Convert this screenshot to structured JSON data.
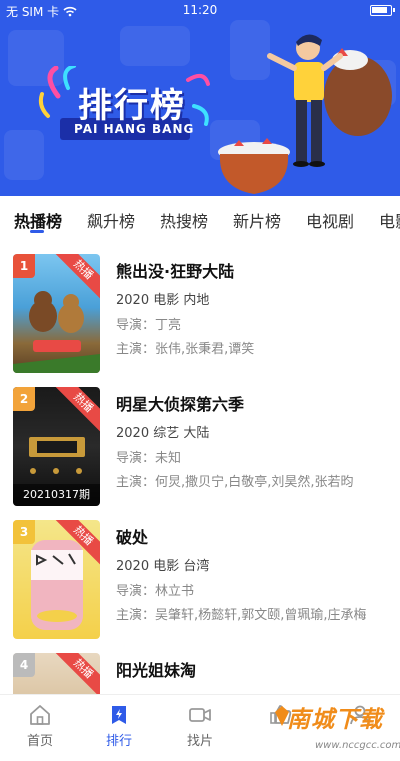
{
  "status_bar": {
    "carrier": "无 SIM 卡",
    "time": "11:20"
  },
  "banner": {
    "title": "排行榜",
    "subtitle": "PAI HANG BANG"
  },
  "tabs": [
    {
      "label": "热播榜",
      "active": true
    },
    {
      "label": "飙升榜"
    },
    {
      "label": "热搜榜"
    },
    {
      "label": "新片榜"
    },
    {
      "label": "电视剧"
    },
    {
      "label": "电影"
    }
  ],
  "list": {
    "director_label": "导演：",
    "cast_label": "主演：",
    "items": [
      {
        "rank": "1",
        "badge": "热播",
        "title": "熊出没·狂野大陆",
        "meta": "2020 电影 内地",
        "director": "丁亮",
        "cast": "张伟,张秉君,谭笑",
        "caption": "",
        "rank_color": "#e8523a"
      },
      {
        "rank": "2",
        "badge": "热播",
        "title": "明星大侦探第六季",
        "meta": "2020 综艺 大陆",
        "director": "未知",
        "cast": "何炅,撒贝宁,白敬亭,刘昊然,张若昀",
        "caption": "20210317期",
        "rank_color": "#f2a33a"
      },
      {
        "rank": "3",
        "badge": "热播",
        "title": "破处",
        "meta": "2020 电影 台湾",
        "director": "林立书",
        "cast": "吴肇轩,杨懿轩,郭文颐,曾珮瑜,庄承梅",
        "caption": "",
        "rank_color": "#f2c23a"
      },
      {
        "rank": "4",
        "badge": "热播",
        "title": "阳光姐妹淘",
        "meta": "",
        "director": "",
        "cast": "",
        "caption": "",
        "rank_color": "#bbbbbb"
      }
    ]
  },
  "bottom_nav": [
    {
      "label": "首页",
      "icon": "home-icon"
    },
    {
      "label": "排行",
      "icon": "ranking-icon",
      "active": true
    },
    {
      "label": "找片",
      "icon": "video-camera-icon"
    },
    {
      "label": "",
      "icon": "thumbs-up-icon"
    },
    {
      "label": "",
      "icon": "profile-icon"
    }
  ],
  "watermark": {
    "text": "南城下载",
    "url": "www.nccgcc.com"
  },
  "colors": {
    "accent": "#2f5be8",
    "badge_red": "#e84a45"
  }
}
